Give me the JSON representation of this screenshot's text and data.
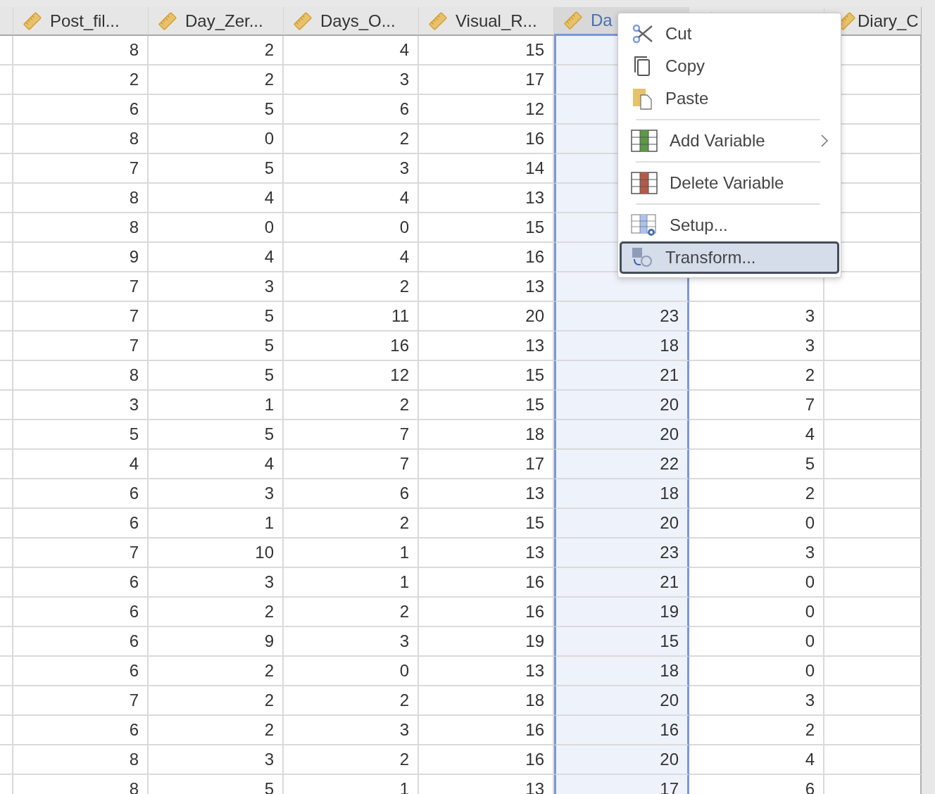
{
  "columns": [
    {
      "label": "Post_fil...",
      "selected": false
    },
    {
      "label": "Day_Zer...",
      "selected": false
    },
    {
      "label": "Days_O...",
      "selected": false
    },
    {
      "label": "Visual_R...",
      "selected": false
    },
    {
      "label": "Da",
      "selected": true
    },
    {
      "selected": false
    },
    {
      "label": "Diary_C",
      "selected": false
    }
  ],
  "rows": [
    {
      "cells": [
        "8",
        "2",
        "4",
        "15",
        null,
        null
      ]
    },
    {
      "cells": [
        "2",
        "2",
        "3",
        "17",
        null,
        null
      ]
    },
    {
      "cells": [
        "6",
        "5",
        "6",
        "12",
        null,
        null
      ]
    },
    {
      "cells": [
        "8",
        "0",
        "2",
        "16",
        null,
        null
      ]
    },
    {
      "cells": [
        "7",
        "5",
        "3",
        "14",
        null,
        null
      ]
    },
    {
      "cells": [
        "8",
        "4",
        "4",
        "13",
        null,
        null
      ]
    },
    {
      "cells": [
        "8",
        "0",
        "0",
        "15",
        null,
        null
      ]
    },
    {
      "cells": [
        "9",
        "4",
        "4",
        "16",
        null,
        null
      ]
    },
    {
      "cells": [
        "7",
        "3",
        "2",
        "13",
        null,
        null
      ]
    },
    {
      "cells": [
        "7",
        "5",
        "11",
        "20",
        "23",
        "3"
      ]
    },
    {
      "cells": [
        "7",
        "5",
        "16",
        "13",
        "18",
        "3"
      ]
    },
    {
      "cells": [
        "8",
        "5",
        "12",
        "15",
        "21",
        "2"
      ]
    },
    {
      "cells": [
        "3",
        "1",
        "2",
        "15",
        "20",
        "7"
      ]
    },
    {
      "cells": [
        "5",
        "5",
        "7",
        "18",
        "20",
        "4"
      ]
    },
    {
      "cells": [
        "4",
        "4",
        "7",
        "17",
        "22",
        "5"
      ]
    },
    {
      "cells": [
        "6",
        "3",
        "6",
        "13",
        "18",
        "2"
      ]
    },
    {
      "cells": [
        "6",
        "1",
        "2",
        "15",
        "20",
        "0"
      ]
    },
    {
      "cells": [
        "7",
        "10",
        "1",
        "13",
        "23",
        "3"
      ]
    },
    {
      "cells": [
        "6",
        "3",
        "1",
        "16",
        "21",
        "0"
      ]
    },
    {
      "cells": [
        "6",
        "2",
        "2",
        "16",
        "19",
        "0"
      ]
    },
    {
      "cells": [
        "6",
        "9",
        "3",
        "19",
        "15",
        "0"
      ]
    },
    {
      "cells": [
        "6",
        "2",
        "0",
        "13",
        "18",
        "0"
      ]
    },
    {
      "cells": [
        "7",
        "2",
        "2",
        "18",
        "20",
        "3"
      ]
    },
    {
      "cells": [
        "6",
        "2",
        "3",
        "16",
        "16",
        "2"
      ]
    },
    {
      "cells": [
        "8",
        "3",
        "2",
        "16",
        "20",
        "4"
      ]
    },
    {
      "cells": [
        "8",
        "5",
        "1",
        "13",
        "17",
        "6"
      ]
    }
  ],
  "context_menu": {
    "items": [
      {
        "label": "Cut",
        "selected": false,
        "separator_before": false,
        "submenu": false
      },
      {
        "label": "Copy",
        "selected": false,
        "separator_before": false,
        "submenu": false
      },
      {
        "label": "Paste",
        "selected": false,
        "separator_before": false,
        "submenu": false
      },
      {
        "label": "Add Variable",
        "selected": false,
        "separator_before": true,
        "submenu": true
      },
      {
        "label": "Delete Variable",
        "selected": false,
        "separator_before": true,
        "submenu": false
      },
      {
        "label": "Setup...",
        "selected": false,
        "separator_before": true,
        "submenu": false
      },
      {
        "label": "Transform...",
        "selected": true,
        "separator_before": false,
        "submenu": false
      }
    ]
  }
}
